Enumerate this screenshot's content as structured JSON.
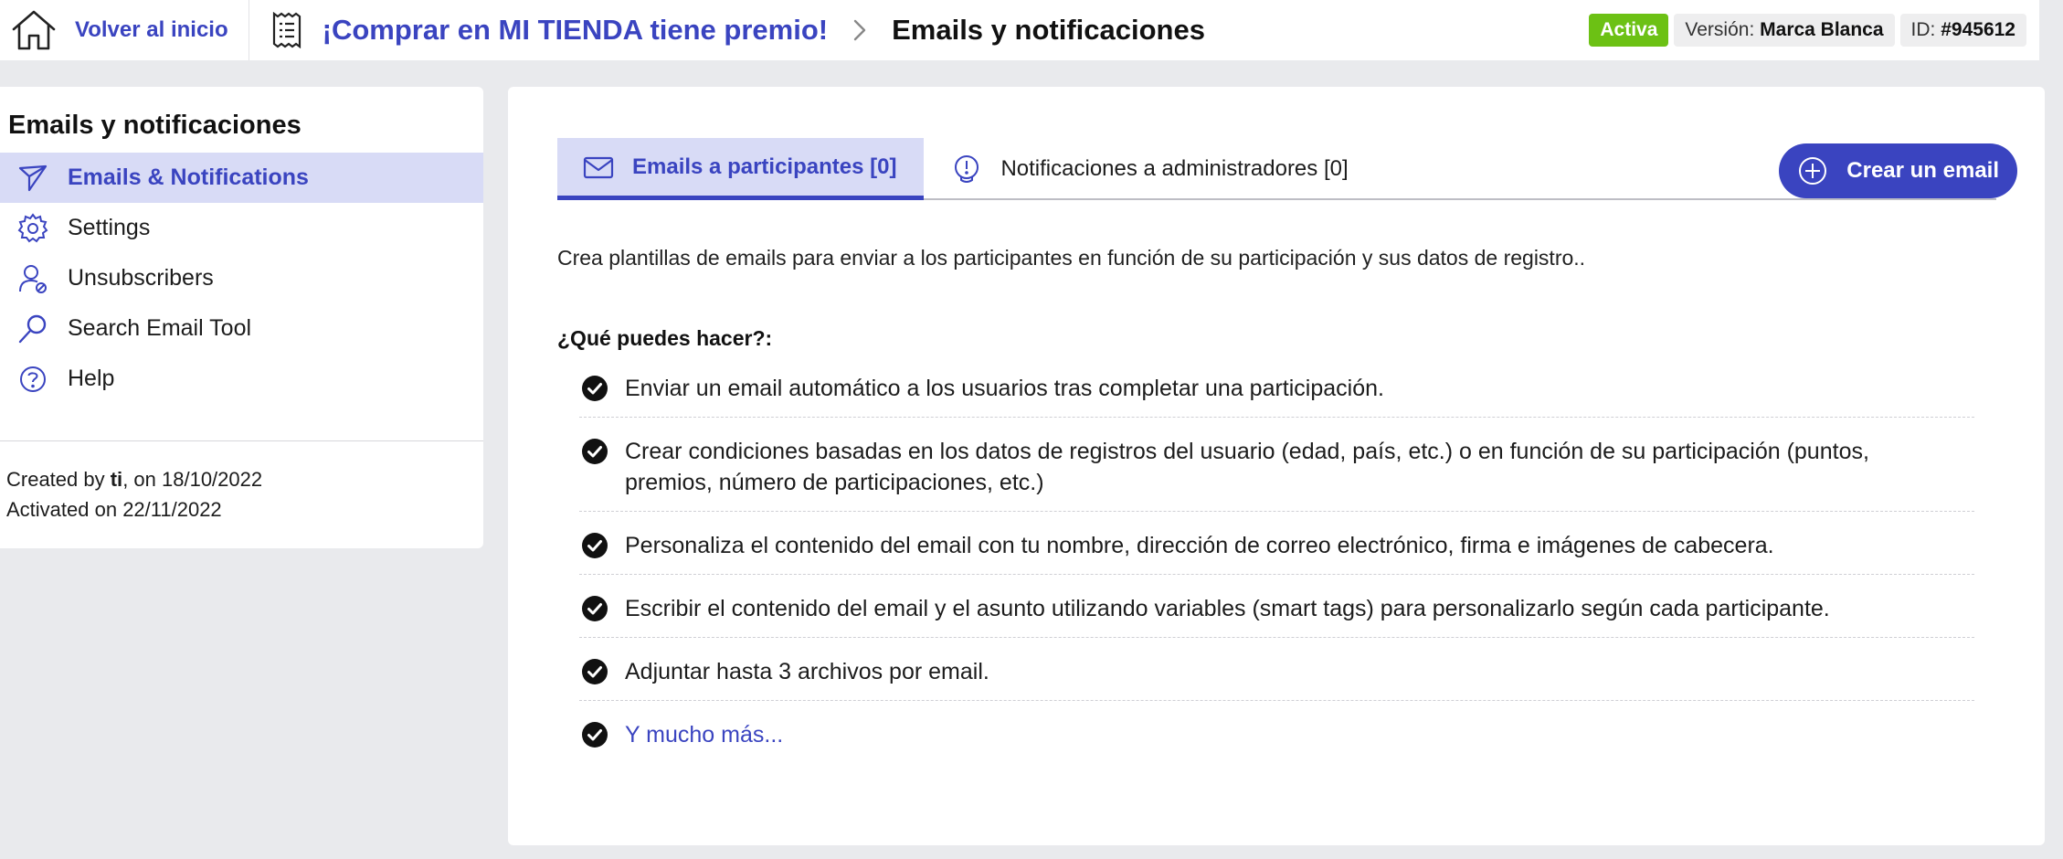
{
  "topbar": {
    "home_label": "Volver al inicio",
    "campaign_title": "¡Comprar en MI TIENDA tiene premio!",
    "current_page": "Emails y notificaciones",
    "status_badge": "Activa",
    "version_label": "Versión:",
    "version_value": "Marca Blanca",
    "id_label": "ID:",
    "id_value": "#945612"
  },
  "sidebar": {
    "title": "Emails y notificaciones",
    "items": [
      {
        "label": "Emails & Notifications",
        "icon": "send-icon",
        "active": true
      },
      {
        "label": "Settings",
        "icon": "gear-icon",
        "active": false
      },
      {
        "label": "Unsubscribers",
        "icon": "user-block-icon",
        "active": false
      },
      {
        "label": "Search Email Tool",
        "icon": "magnifier-icon",
        "active": false
      },
      {
        "label": "Help",
        "icon": "help-icon",
        "active": false
      }
    ],
    "created_prefix": "Created by ",
    "created_user": "ti",
    "created_suffix": ", on 18/10/2022",
    "activated": "Activated on 22/11/2022"
  },
  "main": {
    "tabs": [
      {
        "label": "Emails a participantes [0]",
        "icon": "envelope-icon",
        "active": true
      },
      {
        "label": "Notificaciones a administradores [0]",
        "icon": "alert-bulb-icon",
        "active": false
      }
    ],
    "create_button": "Crear un email",
    "intro": "Crea plantillas de emails para enviar a los participantes en función de su participación y sus datos de registro..",
    "what_title": "¿Qué puedes hacer?:",
    "features": [
      "Enviar un email automático a los usuarios tras completar una participación.",
      "Crear condiciones basadas en los datos de registros del usuario (edad, país, etc.) o en función de su participación (puntos, premios, número de participaciones, etc.)",
      "Personaliza el contenido del email con tu nombre, dirección de correo electrónico, firma e imágenes de cabecera.",
      "Escribir el contenido del email y el asunto utilizando variables (smart tags) para personalizarlo según cada participante.",
      "Adjuntar hasta 3 archivos por email.",
      "Y mucho más..."
    ]
  },
  "colors": {
    "accent": "#3a44c0",
    "accent_light": "#d8dbf6",
    "active_badge": "#6cc114",
    "background": "#e9eaed"
  }
}
